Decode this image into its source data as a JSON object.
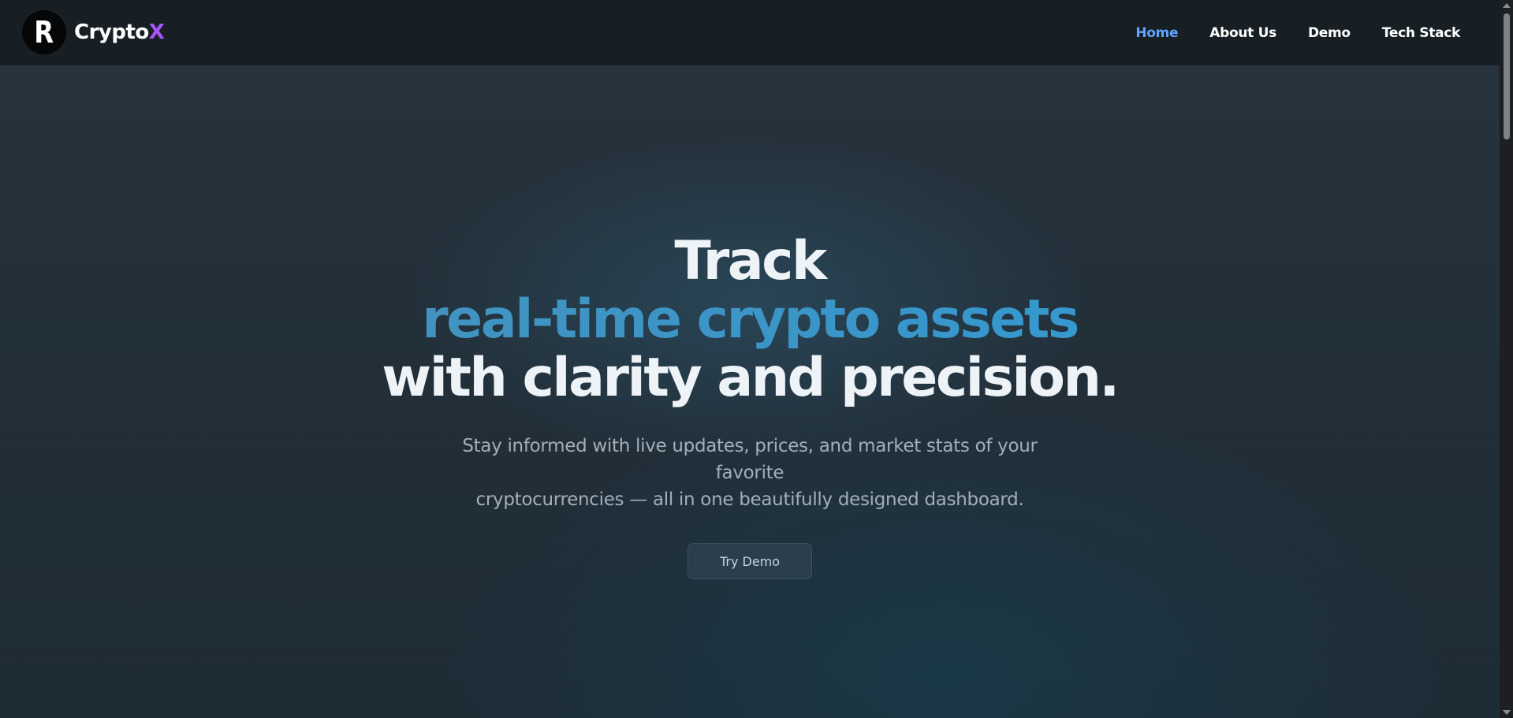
{
  "navbar": {
    "logo_letter": "R",
    "brand_main": "Crypto",
    "brand_accent": "X",
    "links": [
      {
        "label": "Home",
        "active": true
      },
      {
        "label": "About Us",
        "active": false
      },
      {
        "label": "Demo",
        "active": false
      },
      {
        "label": "Tech Stack",
        "active": false
      }
    ]
  },
  "hero": {
    "line1": "Track",
    "line2": "real-time crypto assets",
    "line3": "with clarity and precision.",
    "subtitle_line1": "Stay informed with live updates, prices, and market stats of your favorite",
    "subtitle_line2": "cryptocurrencies — all in one beautifully designed dashboard.",
    "cta_label": "Try Demo"
  },
  "colors": {
    "brand_accent": "#a855f7",
    "nav_active": "#60a5fa",
    "hero_accent_start": "#4a90b8",
    "hero_accent_end": "#2d9bd6"
  }
}
